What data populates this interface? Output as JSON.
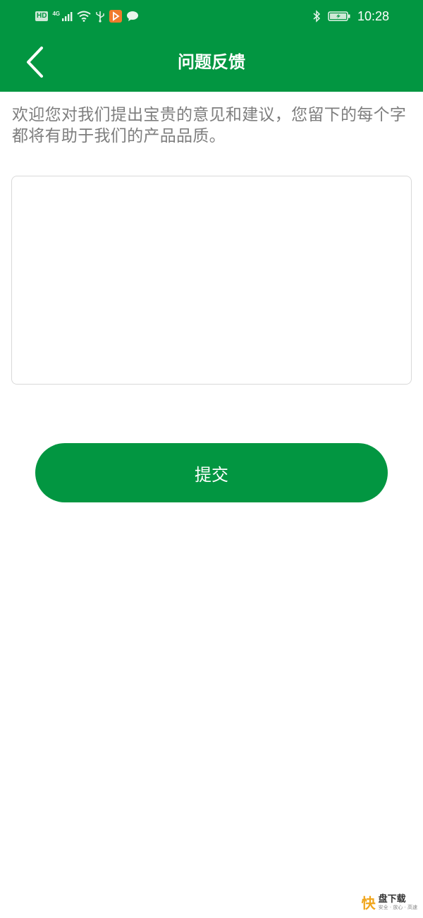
{
  "status_bar": {
    "hd_label": "HD",
    "network_label": "4G",
    "time": "10:28",
    "icons": [
      "hd-icon",
      "signal-icon",
      "wifi-icon",
      "usb-icon",
      "app-notification-icon",
      "chat-icon",
      "bluetooth-icon",
      "battery-icon"
    ]
  },
  "header": {
    "title": "问题反馈",
    "back_icon": "chevron-left-icon"
  },
  "intro": {
    "text": "欢迎您对我们提出宝贵的意见和建议，您留下的每个字都将有助于我们的产品品质。"
  },
  "feedback": {
    "value": "",
    "placeholder": ""
  },
  "submit": {
    "label": "提交"
  },
  "watermark": {
    "kuai": "快",
    "name": "盘下载",
    "slogan": "安全 · 放心 · 高速"
  },
  "colors": {
    "brand_green": "#029641",
    "text_gray": "#7e7e7e",
    "border_gray": "#d9d9d9"
  }
}
